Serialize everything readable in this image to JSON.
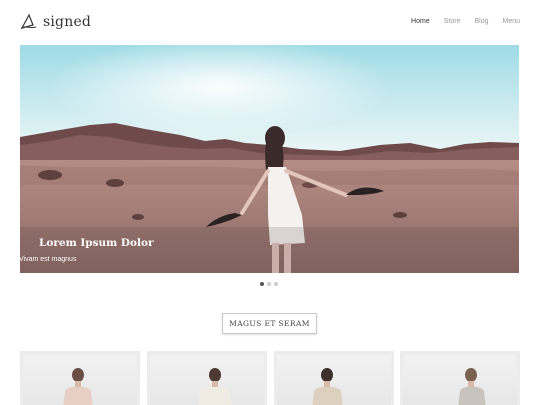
{
  "logo": {
    "text": "signed",
    "icon": "pen-nib-icon"
  },
  "nav": {
    "items": [
      {
        "label": "Home",
        "active": true
      },
      {
        "label": "Store",
        "active": false
      },
      {
        "label": "Blog",
        "active": false
      },
      {
        "label": "Menu",
        "active": false
      }
    ]
  },
  "hero": {
    "title": "Lorem Ipsum Dolor",
    "subtitle": "Vivam est magnus"
  },
  "slider": {
    "slides": 3,
    "active": 1
  },
  "section": {
    "button_label": "MAGUS ET SERAM"
  },
  "colors": {
    "nav_active": "#333333",
    "nav_inactive": "#999999",
    "sky": "#bfe8ef",
    "sand": "#a7807a"
  }
}
